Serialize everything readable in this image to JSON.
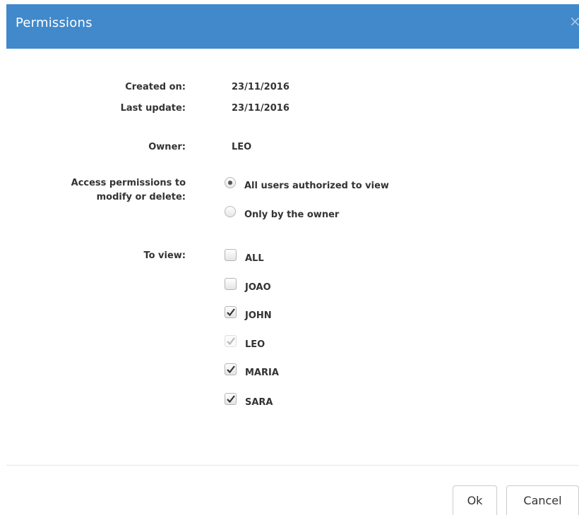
{
  "dialog": {
    "title": "Permissions",
    "close_glyph": "×"
  },
  "info": {
    "created_label": "Created on:",
    "created_value": "23/11/2016",
    "updated_label": "Last update:",
    "updated_value": "23/11/2016",
    "owner_label": "Owner:",
    "owner_value": "LEO"
  },
  "access": {
    "label_line1": "Access permissions to",
    "label_line2": "modify or delete:",
    "options": [
      {
        "label": "All users authorized to view",
        "selected": true
      },
      {
        "label": "Only by the owner",
        "selected": false
      }
    ]
  },
  "view": {
    "label": "To view:",
    "users": [
      {
        "name": "ALL",
        "checked": false,
        "disabled": false
      },
      {
        "name": "JOAO",
        "checked": false,
        "disabled": false
      },
      {
        "name": "JOHN",
        "checked": true,
        "disabled": false
      },
      {
        "name": "LEO",
        "checked": true,
        "disabled": true
      },
      {
        "name": "MARIA",
        "checked": true,
        "disabled": false
      },
      {
        "name": "SARA",
        "checked": true,
        "disabled": false
      }
    ]
  },
  "footer": {
    "ok_label": "Ok",
    "cancel_label": "Cancel"
  },
  "colors": {
    "header_bg": "#4189cb",
    "header_text": "#ffffff"
  }
}
